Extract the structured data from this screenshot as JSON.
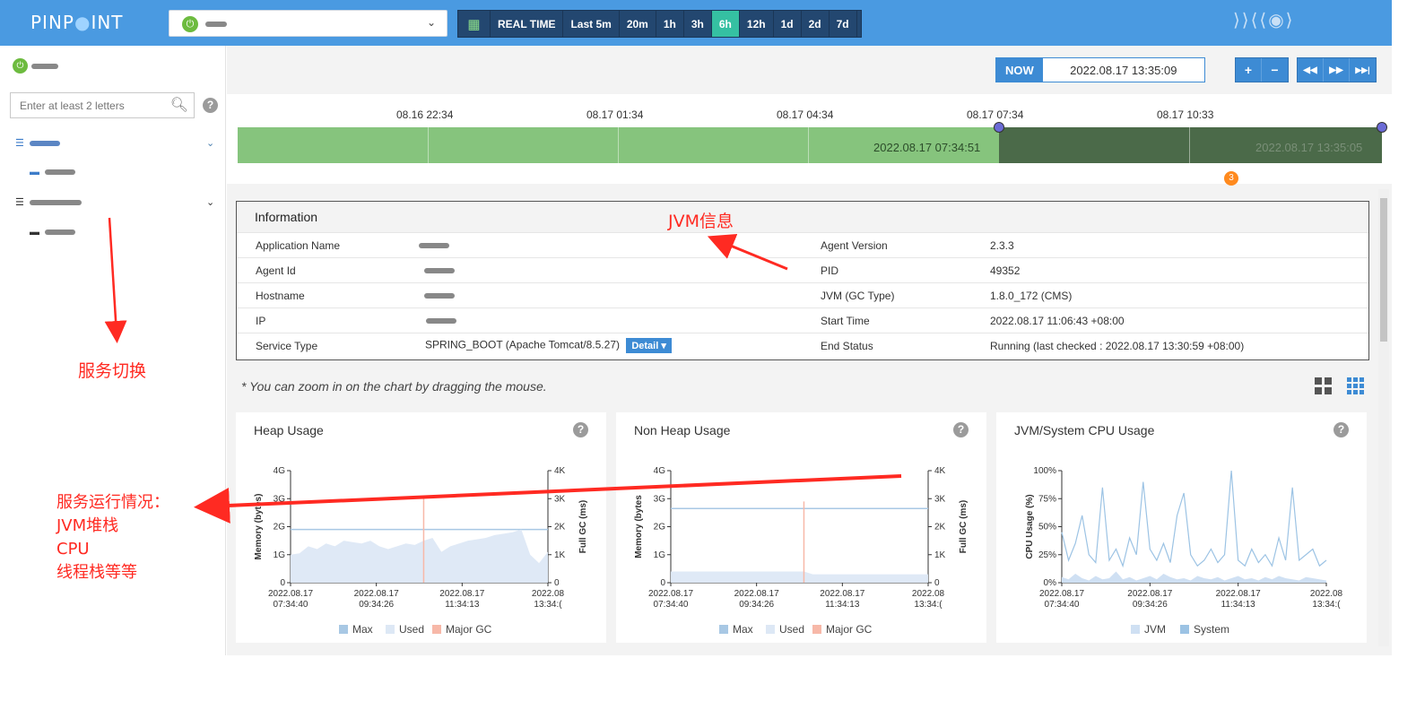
{
  "header": {
    "logo": "PINPOINT",
    "timeframe": [
      "REAL TIME",
      "Last 5m",
      "20m",
      "1h",
      "3h",
      "6h",
      "12h",
      "1d",
      "2d",
      "7d"
    ],
    "active_timeframe": "6h"
  },
  "sidebar": {
    "search_placeholder": "Enter at least 2 letters",
    "help_glyph": "?"
  },
  "time": {
    "now_label": "NOW",
    "now_value": "2022.08.17 13:35:09",
    "plus": "+",
    "minus": "−",
    "prev": "◀◀",
    "next": "▶▶",
    "end": "▶▶|"
  },
  "timeline": {
    "labels": [
      "08.16 22:34",
      "08.17 01:34",
      "08.17 04:34",
      "08.17 07:34",
      "08.17 10:33"
    ],
    "selection_start": "2022.08.17 07:34:51",
    "selection_end": "2022.08.17 13:35:05",
    "alert_count": "3"
  },
  "info": {
    "title": "Information",
    "left": [
      {
        "label": "Application Name"
      },
      {
        "label": "Agent Id"
      },
      {
        "label": "Hostname"
      },
      {
        "label": "IP"
      },
      {
        "label": "Service Type",
        "value": "SPRING_BOOT (Apache Tomcat/8.5.27)",
        "button": "Detail ▾"
      }
    ],
    "right": [
      {
        "label": "Agent Version",
        "value": "2.3.3"
      },
      {
        "label": "PID",
        "value": "49352"
      },
      {
        "label": "JVM (GC Type)",
        "value": "1.8.0_172 (CMS)"
      },
      {
        "label": "Start Time",
        "value": "2022.08.17 11:06:43 +08:00"
      },
      {
        "label": "End Status",
        "value": "Running (last checked : 2022.08.17 13:30:59 +08:00)"
      }
    ]
  },
  "zoom_note": "* You can zoom in on the chart by dragging the mouse.",
  "annotations": {
    "jvm": "JVM信息",
    "switch": "服务切换",
    "runtime": [
      "服务运行情况：",
      "JVM堆栈",
      "CPU",
      "线程栈等等"
    ]
  },
  "chart_data": [
    {
      "type": "area",
      "title": "Heap Usage",
      "ylabel": "Memory (bytes)",
      "y2label": "Full GC (ms)",
      "yticks": [
        "0",
        "1G",
        "2G",
        "3G",
        "4G"
      ],
      "y2ticks": [
        "0",
        "1K",
        "2K",
        "3K",
        "4K"
      ],
      "xticks": [
        [
          "2022.08.17",
          "07:34:40"
        ],
        [
          "2022.08.17",
          "09:34:26"
        ],
        [
          "2022.08.17",
          "11:34:13"
        ],
        [
          "2022.08",
          "13:34:("
        ]
      ],
      "ylim": [
        0,
        4
      ],
      "legend": [
        "Max",
        "Used",
        "Major GC"
      ],
      "series": [
        {
          "name": "Max",
          "values": [
            1.9,
            1.9,
            1.9,
            1.9,
            1.9,
            1.9,
            1.9,
            1.9,
            1.9,
            1.9,
            1.9,
            1.9,
            1.9,
            1.9,
            1.9,
            1.9,
            1.9,
            1.9,
            1.9,
            1.9,
            1.9,
            1.9,
            1.9,
            1.9,
            1.9,
            1.9,
            1.9,
            1.9,
            1.9,
            1.9
          ]
        },
        {
          "name": "Used",
          "values": [
            1.0,
            1.05,
            1.3,
            1.2,
            1.4,
            1.3,
            1.5,
            1.45,
            1.4,
            1.5,
            1.3,
            1.2,
            1.3,
            1.4,
            1.35,
            1.5,
            1.6,
            1.1,
            1.3,
            1.4,
            1.5,
            1.55,
            1.6,
            1.7,
            1.75,
            1.8,
            1.9,
            1.0,
            0.7,
            1.1
          ]
        },
        {
          "name": "Major GC",
          "values": [
            0,
            0,
            0,
            0,
            0,
            0,
            0,
            0,
            0,
            0,
            0,
            0,
            0,
            0,
            0,
            3.1,
            0,
            0,
            0,
            0,
            0,
            0,
            0,
            0,
            0,
            0,
            0,
            0,
            0,
            0
          ]
        }
      ],
      "colors": [
        "#a8c8e4",
        "#dde8f5",
        "#f7b8a8"
      ]
    },
    {
      "type": "area",
      "title": "Non Heap Usage",
      "ylabel": "Memory (bytes",
      "y2label": "Full GC (ms)",
      "yticks": [
        "0",
        "1G",
        "2G",
        "3G",
        "4G"
      ],
      "y2ticks": [
        "0",
        "1K",
        "2K",
        "3K",
        "4K"
      ],
      "xticks": [
        [
          "2022.08.17",
          "07:34:40"
        ],
        [
          "2022.08.17",
          "09:34:26"
        ],
        [
          "2022.08.17",
          "11:34:13"
        ],
        [
          "2022.08",
          "13:34:("
        ]
      ],
      "ylim": [
        0,
        4
      ],
      "legend": [
        "Max",
        "Used",
        "Major GC"
      ],
      "series": [
        {
          "name": "Max",
          "values": [
            2.65,
            2.65,
            2.65,
            2.65,
            2.65,
            2.65,
            2.65,
            2.65,
            2.65,
            2.65,
            2.65,
            2.65,
            2.65,
            2.65,
            2.65,
            2.65,
            2.65,
            2.65,
            2.65,
            2.65,
            2.65,
            2.65,
            2.65,
            2.65,
            2.65,
            2.65,
            2.65,
            2.65,
            2.65,
            2.65
          ]
        },
        {
          "name": "Used",
          "values": [
            0.4,
            0.4,
            0.4,
            0.4,
            0.4,
            0.4,
            0.4,
            0.4,
            0.4,
            0.4,
            0.4,
            0.4,
            0.4,
            0.4,
            0.4,
            0.4,
            0.3,
            0.3,
            0.3,
            0.3,
            0.3,
            0.3,
            0.3,
            0.3,
            0.3,
            0.3,
            0.3,
            0.3,
            0.3,
            0.3
          ]
        },
        {
          "name": "Major GC",
          "values": [
            0,
            0,
            0,
            0,
            0,
            0,
            0,
            0,
            0,
            0,
            0,
            0,
            0,
            0,
            0,
            2.9,
            0,
            0,
            0,
            0,
            0,
            0,
            0,
            0,
            0,
            0,
            0,
            0,
            0,
            0
          ]
        }
      ],
      "colors": [
        "#a8c8e4",
        "#dde8f5",
        "#f7b8a8"
      ]
    },
    {
      "type": "line",
      "title": "JVM/System CPU Usage",
      "ylabel": "CPU Usage (%)",
      "yticks": [
        "0%",
        "25%",
        "50%",
        "75%",
        "100%"
      ],
      "xticks": [
        [
          "2022.08.17",
          "07:34:40"
        ],
        [
          "2022.08.17",
          "09:34:26"
        ],
        [
          "2022.08.17",
          "11:34:13"
        ],
        [
          "2022.08",
          "13:34:("
        ]
      ],
      "ylim": [
        0,
        100
      ],
      "legend": [
        "JVM",
        "System"
      ],
      "series": [
        {
          "name": "JVM",
          "values": [
            5,
            3,
            8,
            4,
            2,
            6,
            3,
            4,
            10,
            3,
            5,
            2,
            4,
            6,
            3,
            8,
            5,
            3,
            4,
            2,
            6,
            4,
            3,
            5,
            2,
            4,
            6,
            3,
            4,
            2,
            5,
            3,
            6,
            4,
            3,
            2,
            5,
            4,
            3,
            2
          ]
        },
        {
          "name": "System",
          "values": [
            45,
            20,
            35,
            60,
            25,
            18,
            85,
            20,
            30,
            15,
            40,
            25,
            90,
            30,
            20,
            35,
            18,
            60,
            80,
            25,
            15,
            20,
            30,
            18,
            25,
            100,
            20,
            15,
            30,
            18,
            25,
            15,
            40,
            20,
            85,
            20,
            25,
            30,
            15,
            20
          ]
        }
      ],
      "colors": [
        "#cfe0f3",
        "#9cc3e4"
      ]
    }
  ]
}
